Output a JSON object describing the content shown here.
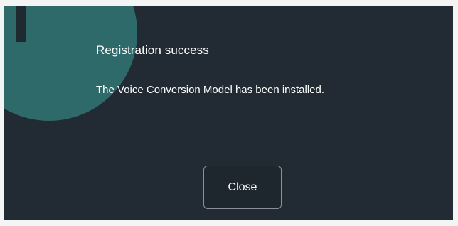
{
  "dialog": {
    "icon": "info-icon",
    "title": "Registration success",
    "message": "The Voice Conversion Model has been installed.",
    "close_label": "Close"
  },
  "colors": {
    "background": "#222b33",
    "icon_circle": "#2f6a6b",
    "text": "#ffffff"
  }
}
